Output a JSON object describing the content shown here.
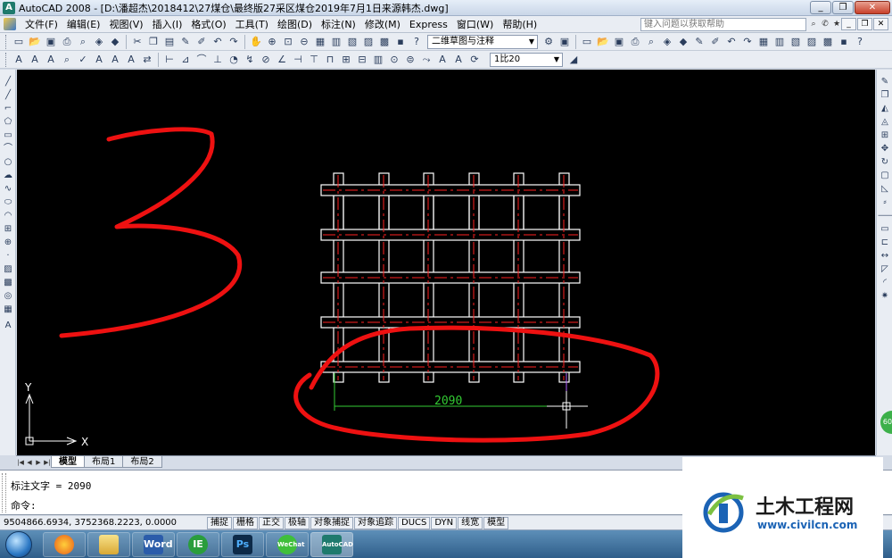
{
  "window": {
    "title": "AutoCAD 2008 - [D:\\潘超杰\\2018412\\27煤仓\\最终版27采区煤仓2019年7月1日来源韩杰.dwg]",
    "app_icon": "A",
    "minimize": "_",
    "restore": "❐",
    "close": "✕"
  },
  "menu": {
    "items": [
      "文件(F)",
      "编辑(E)",
      "视图(V)",
      "插入(I)",
      "格式(O)",
      "工具(T)",
      "绘图(D)",
      "标注(N)",
      "修改(M)",
      "Express",
      "窗口(W)",
      "帮助(H)"
    ],
    "help_placeholder": "键入问题以获取帮助",
    "mdi_min": "_",
    "mdi_restore": "❐",
    "mdi_close": "✕"
  },
  "toolbar": {
    "workspace": "二维草图与注释",
    "annotation_scale": "1比20"
  },
  "drawing": {
    "dimension_text": "2090",
    "annotation_number": "3",
    "ucs_y": "Y",
    "ucs_x": "X"
  },
  "tabs": {
    "items": [
      "模型",
      "布局1",
      "布局2"
    ],
    "active": "模型"
  },
  "command": {
    "line1": "标注文字 = 2090",
    "line2": "命令:"
  },
  "status": {
    "coords": "9504866.6934, 3752368.2223, 0.0000",
    "buttons": [
      "捕捉",
      "栅格",
      "正交",
      "极轴",
      "对象捕捉",
      "对象追踪",
      "DUCS",
      "DYN",
      "线宽",
      "模型"
    ]
  },
  "taskbar": {
    "apps": [
      "Word",
      "IE",
      "Ps",
      "WeChat",
      "AutoCAD"
    ]
  },
  "watermark": {
    "name": "土木工程网",
    "url": "www.civilcn.com"
  },
  "side_badge": "60",
  "colors": {
    "canvas": "#000000",
    "drawing_lines": "#ffffff",
    "center_lines": "#ff2020",
    "dimension": "#33cc33",
    "annotation": "#ee1111"
  }
}
